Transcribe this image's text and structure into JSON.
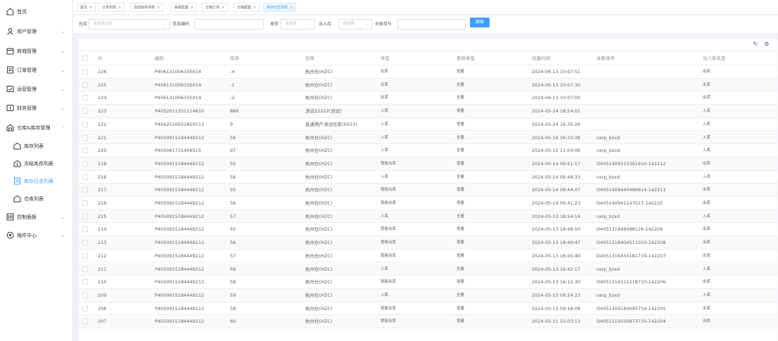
{
  "sidebar": {
    "items": [
      {
        "label": "首页",
        "icon": "home-icon",
        "arrow": ""
      },
      {
        "label": "用户管理",
        "icon": "user-icon",
        "arrow": "⌄"
      },
      {
        "label": "商城管理",
        "icon": "shop-icon",
        "arrow": "⌄"
      },
      {
        "label": "订单管理",
        "icon": "order-icon",
        "arrow": "⌄"
      },
      {
        "label": "运营管理",
        "icon": "operation-icon",
        "arrow": "⌄"
      },
      {
        "label": "财务管理",
        "icon": "finance-icon",
        "arrow": "⌄"
      },
      {
        "label": "仓库&库存管理",
        "icon": "warehouse-icon",
        "arrow": "⌃"
      }
    ],
    "sub_items": [
      {
        "label": "库存列表",
        "icon": "stock-icon"
      },
      {
        "label": "冻结库存列表",
        "icon": "frozen-icon"
      },
      {
        "label": "库存日志列表",
        "icon": "log-icon"
      },
      {
        "label": "仓库列表",
        "icon": "warehouse-list-icon"
      }
    ],
    "bottom_items": [
      {
        "label": "控制面板",
        "icon": "dashboard-icon",
        "arrow": "⌄"
      },
      {
        "label": "插件中心",
        "icon": "plugin-icon",
        "arrow": "⌄"
      }
    ],
    "active_color": "#409eff"
  },
  "tabs": [
    {
      "label": "首页",
      "close": "×"
    },
    {
      "label": "订单列表",
      "close": "×"
    },
    {
      "label": "冻结库存列表",
      "close": "×"
    },
    {
      "label": "系统配置",
      "close": "×"
    },
    {
      "label": "分销订单",
      "close": "×"
    },
    {
      "label": "分销配置",
      "close": "×"
    },
    {
      "label": "库存日志列表",
      "close": "×"
    }
  ],
  "filter": {
    "warehouse_label": "仓库",
    "warehouse_placeholder": "请选择仓库",
    "sku_label": "货品编码",
    "sku_value": "",
    "type_label": "类型",
    "type_placeholder": "请选择",
    "inout_label": "出入库",
    "inout_placeholder": "请选择",
    "ref_label": "关联单号",
    "ref_value": "",
    "search_button": "搜索",
    "arrow": "⌄"
  },
  "toolbar": {
    "refresh_glyph": "↻",
    "columns_glyph": "⚙"
  },
  "table": {
    "headers": [
      "ID",
      "编码",
      "结存",
      "仓库",
      "类型",
      "更新类型",
      "创建时间",
      "关联单号",
      "出入库状态"
    ],
    "rows": [
      [
        "226",
        "P406131006335014",
        "-4",
        "杭州仓(HZC)",
        "出库",
        "增量",
        "2024-06-13 10:07:51",
        "",
        "出库"
      ],
      [
        "225",
        "P406131006335014",
        "-1",
        "杭州仓(HZC)",
        "出库",
        "全量",
        "2024-06-13 10:07:30",
        "",
        "出库"
      ],
      [
        "224",
        "P406131006335014",
        "-2",
        "杭州仓(HZC)",
        "出库",
        "全量",
        "2024-06-13 10:07:00",
        "",
        "出库"
      ],
      [
        "223",
        "P4052011351114610",
        "880",
        "测试22222(测试)",
        "入库",
        "增量",
        "2024-05-24 18:24:01",
        "",
        "入库"
      ],
      [
        "222",
        "P4042510022850513",
        "9",
        "普通用户测试仓库(0023)",
        "入库",
        "增量",
        "2024-05-24 16:35:26",
        "",
        "入库"
      ],
      [
        "221",
        "P4050915184449212",
        "56",
        "杭州仓(HZC)",
        "入库",
        "全量",
        "2024-05-16 16:33:28",
        "cerp_bzxd",
        "入库"
      ],
      [
        "220",
        "P405081715409515",
        "97",
        "杭州仓(HZC)",
        "入库",
        "全量",
        "2024-05-15 11:04:06",
        "cerp_bzxd",
        "入库"
      ],
      [
        "219",
        "P4050915184449212",
        "55",
        "杭州仓(HZC)",
        "销售出库",
        "增量",
        "2024-05-14 09:51:57",
        "D405140951536191​0-142212",
        "出库"
      ],
      [
        "218",
        "P4050915184449212",
        "56",
        "杭州仓(HZC)",
        "入库",
        "全量",
        "2024-05-14 09:48:33",
        "cerp_bzxd",
        "入库"
      ],
      [
        "217",
        "P4050915184449212",
        "55",
        "杭州仓(HZC)",
        "销售出库",
        "增量",
        "2024-05-14 09:44:07",
        "D405140944048691​4-142211",
        "出库"
      ],
      [
        "216",
        "P4050915184449212",
        "56",
        "杭州仓(HZC)",
        "销售出库",
        "增量",
        "2024-05-14 09:41:23",
        "D405140941147017-142210",
        "出库"
      ],
      [
        "215",
        "P4050915184449212",
        "57",
        "杭州仓(HZC)",
        "入库",
        "全量",
        "2024-05-13 18:54:14",
        "cerp_bzxd",
        "入库"
      ],
      [
        "214",
        "P4050915184449212",
        "55",
        "杭州仓(HZC)",
        "销售出库",
        "增量",
        "2024-05-13 18:48:50",
        "D405131848488116-142209",
        "出库"
      ],
      [
        "213",
        "P4050915184449212",
        "56",
        "杭州仓(HZC)",
        "销售出库",
        "增量",
        "2024-05-13 18:40:47",
        "D405131840451101​0-142208",
        "出库"
      ],
      [
        "212",
        "P4050915184449212",
        "57",
        "杭州仓(HZC)",
        "销售出库",
        "增量",
        "2024-05-13 16:45:49",
        "D405131645418171​9-142207",
        "出库"
      ],
      [
        "211",
        "P4050915184449212",
        "59",
        "杭州仓(HZC)",
        "入库",
        "全量",
        "2024-05-13 16:42:17",
        "cerp_bzxd",
        "入库"
      ],
      [
        "210",
        "P4050915184449212",
        "58",
        "杭州仓(HZC)",
        "销售出库",
        "增量",
        "2024-05-13 16:12:30",
        "D405131612221871​0-142206",
        "出库"
      ],
      [
        "209",
        "P4050915184449212",
        "59",
        "杭州仓(HZC)",
        "入库",
        "全量",
        "2024-05-13 09:24:23",
        "cerp_bzxd",
        "入库"
      ],
      [
        "208",
        "P4050915184449212",
        "58",
        "杭州仓(HZC)",
        "销售出库",
        "增量",
        "2024-05-13 09:18:09",
        "D405130918009571​9-142205",
        "出库"
      ],
      [
        "207",
        "P4050915184449212",
        "60",
        "杭州仓(HZC)",
        "销售出库",
        "增量",
        "2024-05-11 15:03:13",
        "D405111503087371​5-142204",
        "出库"
      ]
    ]
  }
}
